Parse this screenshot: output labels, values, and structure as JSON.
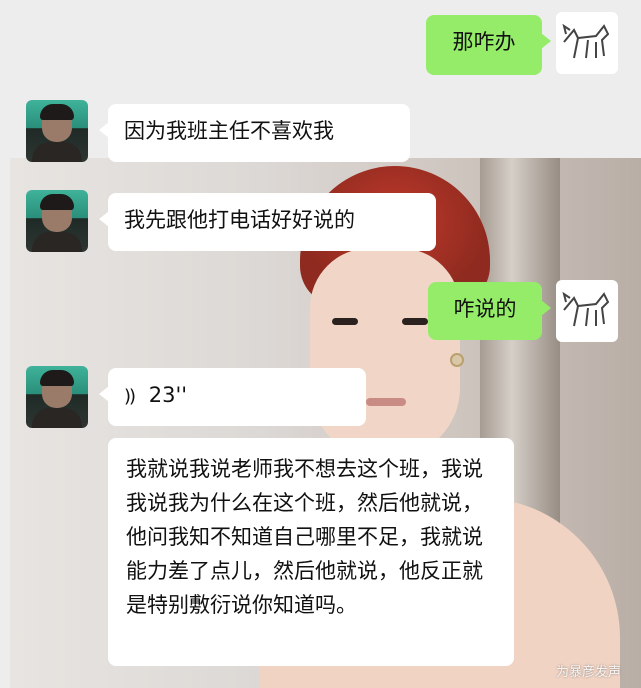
{
  "messages": [
    {
      "side": "right",
      "text": "那咋办"
    },
    {
      "side": "left",
      "text": "因为我班主任不喜欢我"
    },
    {
      "side": "left",
      "text": "我先跟他打电话好好说的"
    },
    {
      "side": "right",
      "text": "咋说的"
    },
    {
      "side": "left",
      "voice_duration": "23''"
    },
    {
      "side": "left",
      "text": "我就说我说老师我不想去这个班，我说我说我为什么在这个班，然后他就说，他问我知不知道自己哪里不足，我就说能力差了点儿，然后他就说，他反正就是特别敷衍说你知道吗。"
    }
  ],
  "voice_icon": "))",
  "watermark": "为暴彦发声",
  "colors": {
    "green_bubble": "#95ec69",
    "white_bubble": "#ffffff",
    "background": "#ededed"
  }
}
